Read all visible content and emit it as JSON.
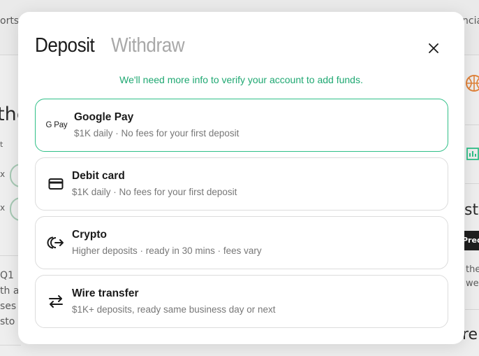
{
  "background": {
    "fragments": [
      "orts",
      "ncia",
      "the",
      "t",
      "x",
      "x",
      "Q1 :",
      "th a",
      "ses",
      "sto",
      "sto",
      "Pred",
      "the",
      "wee",
      "ren"
    ]
  },
  "modal": {
    "tabs": [
      {
        "label": "Deposit",
        "active": true
      },
      {
        "label": "Withdraw",
        "active": false
      }
    ],
    "close_icon": "close-icon",
    "notice": "We'll need more info to verify your account to add funds.",
    "options": [
      {
        "id": "google-pay",
        "icon": "google-pay-icon",
        "icon_text": "G Pay",
        "title": "Google Pay",
        "subtitle": "$1K daily · No fees for your first deposit",
        "selected": true
      },
      {
        "id": "debit-card",
        "icon": "credit-card-icon",
        "title": "Debit card",
        "subtitle": "$1K daily · No fees for your first deposit",
        "selected": false
      },
      {
        "id": "crypto",
        "icon": "crypto-icon",
        "title": "Crypto",
        "subtitle": "Higher deposits · ready in 30 mins · fees vary",
        "selected": false
      },
      {
        "id": "wire-transfer",
        "icon": "transfer-arrows-icon",
        "title": "Wire transfer",
        "subtitle": "$1K+ deposits, ready same business day or next",
        "selected": false
      }
    ]
  },
  "colors": {
    "accent": "#2fbf87",
    "notice": "#1fa872",
    "text": "#1a1a1a",
    "muted": "#777777"
  }
}
